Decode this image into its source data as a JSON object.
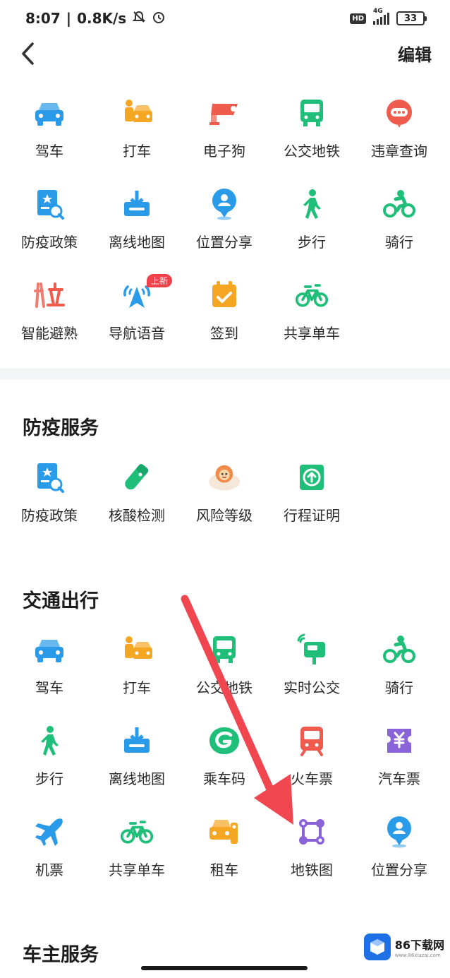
{
  "status_bar": {
    "time": "8:07",
    "speed": "0.8K/s",
    "hd": "HD",
    "network": "4G",
    "battery": "33"
  },
  "nav": {
    "edit_label": "编辑"
  },
  "favorites": [
    {
      "label": "驾车",
      "icon": "car-icon"
    },
    {
      "label": "打车",
      "icon": "taxi-icon"
    },
    {
      "label": "电子狗",
      "icon": "speed-camera-icon"
    },
    {
      "label": "公交地铁",
      "icon": "bus-icon"
    },
    {
      "label": "违章查询",
      "icon": "violation-query-icon"
    },
    {
      "label": "防疫政策",
      "icon": "epidemic-policy-icon"
    },
    {
      "label": "离线地图",
      "icon": "offline-map-icon"
    },
    {
      "label": "位置分享",
      "icon": "location-share-icon"
    },
    {
      "label": "步行",
      "icon": "walk-icon"
    },
    {
      "label": "骑行",
      "icon": "cycling-icon"
    },
    {
      "label": "智能避熟",
      "icon": "smart-avoid-icon"
    },
    {
      "label": "导航语音",
      "icon": "navigation-voice-icon",
      "badge": "上新"
    },
    {
      "label": "签到",
      "icon": "check-in-icon"
    },
    {
      "label": "共享单车",
      "icon": "shared-bike-icon"
    }
  ],
  "sections": [
    {
      "title": "防疫服务",
      "items": [
        {
          "label": "防疫政策",
          "icon": "epidemic-policy-icon"
        },
        {
          "label": "核酸检测",
          "icon": "nucleic-test-icon"
        },
        {
          "label": "风险等级",
          "icon": "risk-level-icon"
        },
        {
          "label": "行程证明",
          "icon": "trip-proof-icon"
        }
      ]
    },
    {
      "title": "交通出行",
      "items": [
        {
          "label": "驾车",
          "icon": "car-icon"
        },
        {
          "label": "打车",
          "icon": "taxi-icon"
        },
        {
          "label": "公交地铁",
          "icon": "bus-icon"
        },
        {
          "label": "实时公交",
          "icon": "realtime-bus-icon"
        },
        {
          "label": "骑行",
          "icon": "cycling-icon"
        },
        {
          "label": "步行",
          "icon": "walk-icon"
        },
        {
          "label": "离线地图",
          "icon": "offline-map-icon"
        },
        {
          "label": "乘车码",
          "icon": "ride-code-icon"
        },
        {
          "label": "火车票",
          "icon": "train-ticket-icon"
        },
        {
          "label": "汽车票",
          "icon": "coach-ticket-icon"
        },
        {
          "label": "机票",
          "icon": "flight-ticket-icon"
        },
        {
          "label": "共享单车",
          "icon": "shared-bike-icon"
        },
        {
          "label": "租车",
          "icon": "car-rental-icon"
        },
        {
          "label": "地铁图",
          "icon": "subway-map-icon"
        },
        {
          "label": "位置分享",
          "icon": "location-share-icon"
        }
      ]
    },
    {
      "title": "车主服务",
      "items": []
    }
  ],
  "watermark": {
    "name": "86下载网",
    "url": "www.86xiazai.com"
  },
  "colors": {
    "blue": "#2a9be8",
    "orange": "#f5a623",
    "red": "#ef5b4c",
    "green": "#1fbf7a",
    "purple": "#8b63d8",
    "arrow": "#f0464f"
  }
}
